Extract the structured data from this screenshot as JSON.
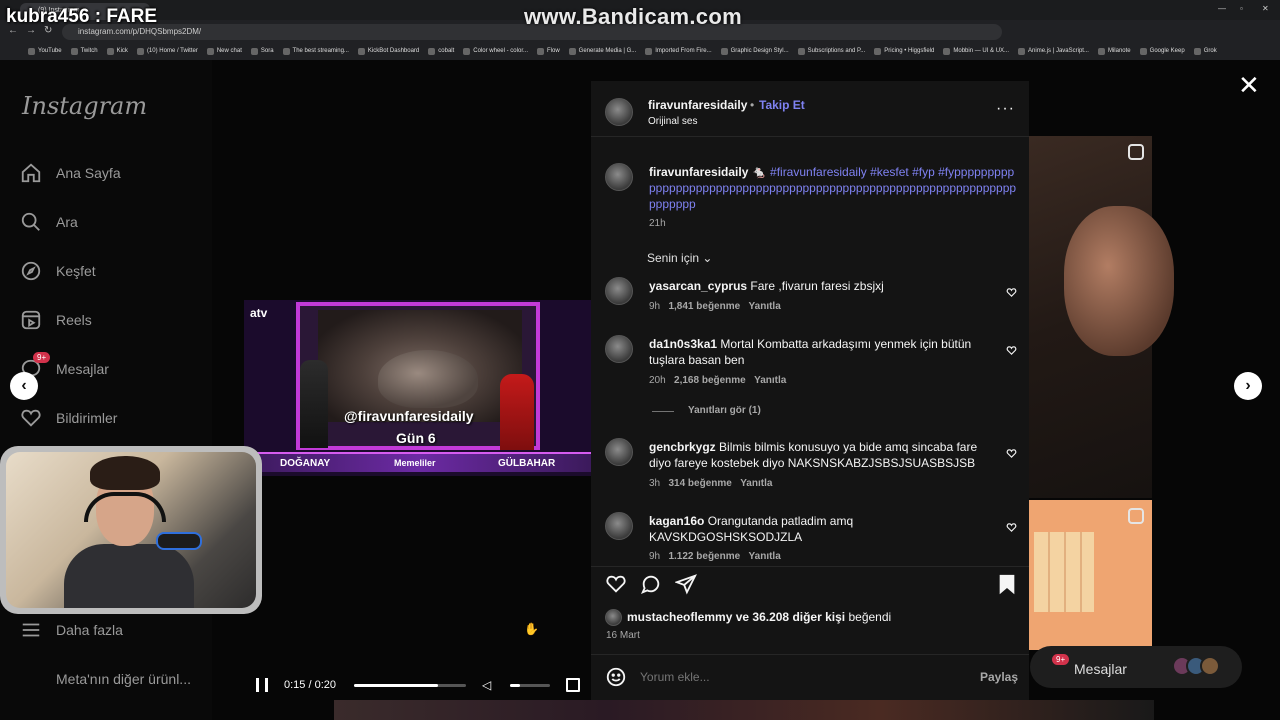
{
  "browser": {
    "tab_title": "(9) Instagram",
    "url": "instagram.com/p/DHQSbmps2DM/",
    "bookmarks": [
      "YouTube",
      "Twitch",
      "Kick",
      "(10) Home / Twitter",
      "New chat",
      "Sora",
      "The best streaming...",
      "KickBot Dashboard",
      "cobalt",
      "Color wheel - color...",
      "Flow",
      "Generate Media | G...",
      "Imported From Fire...",
      "Graphic Design Styl...",
      "Subscriptions and P...",
      "Pricing • Higgsfield",
      "Mobbin — UI & UX...",
      "Anime.js | JavaScript...",
      "Milanote",
      "Google Keep",
      "Grok"
    ]
  },
  "overlay": {
    "streamer_title": "kubra456 : FARE",
    "watermark": "www.Bandicam.com"
  },
  "sidebar": {
    "logo": "Instagram",
    "items": [
      {
        "label": "Ana Sayfa",
        "icon": "home-icon"
      },
      {
        "label": "Ara",
        "icon": "search-icon"
      },
      {
        "label": "Keşfet",
        "icon": "compass-icon"
      },
      {
        "label": "Reels",
        "icon": "reels-icon"
      },
      {
        "label": "Mesajlar",
        "icon": "messenger-icon",
        "badge": "9+"
      },
      {
        "label": "Bildirimler",
        "icon": "heart-icon"
      }
    ],
    "more": "Daha fazla",
    "meta": "Meta'nın diğer ürünl..."
  },
  "video": {
    "channel_logo": "atv",
    "handle": "@firavunfaresidaily",
    "day": "Gün 6",
    "left_label": "DOĞANAY",
    "center_label": "Memeliler",
    "right_label": "GÜLBAHAR",
    "time": "0:15 / 0:20",
    "progress": 0.75,
    "volume": 0.25
  },
  "post": {
    "author": "firavunfaresidaily",
    "follow": "Takip Et",
    "audio": "Orijinal ses",
    "caption_author": "firavunfaresidaily",
    "caption_emoji": "🐁",
    "caption_tags": "#firavunfaresidaily #kesfet #fyp #fyppppppppppppppppppppppppppppppppppppppppppppppppppppppppppppppppppppppp",
    "caption_age": "21h",
    "sort": "Senin için",
    "comments": [
      {
        "user": "yasarcan_cyprus",
        "text": "Fare ,fivarun faresi zbsjxj",
        "age": "9h",
        "likes": "1,841 beğenme",
        "reply": "Yanıtla"
      },
      {
        "user": "da1n0s3ka1",
        "text": "Mortal Kombatta arkadaşımı yenmek için bütün tuşlara basan ben",
        "age": "20h",
        "likes": "2,168 beğenme",
        "reply": "Yanıtla",
        "view_replies": "Yanıtları gör (1)"
      },
      {
        "user": "gencbrkygz",
        "text": "Bilmis bilmis konusuyo ya bide amq sincaba fare diyo fareye kostebek diyo NAKSNSKABZJSBSJSUASBSJSB",
        "age": "3h",
        "likes": "314 beğenme",
        "reply": "Yanıtla"
      },
      {
        "user": "kagan16o",
        "text": "Orangutanda patladim amq KAVSKDGOSHSKSODJZLA",
        "age": "9h",
        "likes": "1.122 beğenme",
        "reply": "Yanıtla"
      }
    ],
    "liked_by_user": "mustacheoflemmy",
    "liked_by_rest": "ve 36.208 diğer kişi",
    "liked_suffix": "beğendi",
    "date": "16 Mart",
    "comment_placeholder": "Yorum ekle...",
    "share": "Paylaş"
  },
  "messages_pill": {
    "label": "Mesajlar",
    "badge": "9+"
  },
  "colors": {
    "accent": "#7f82f2",
    "panel": "#141414",
    "badge": "#d2324b"
  }
}
